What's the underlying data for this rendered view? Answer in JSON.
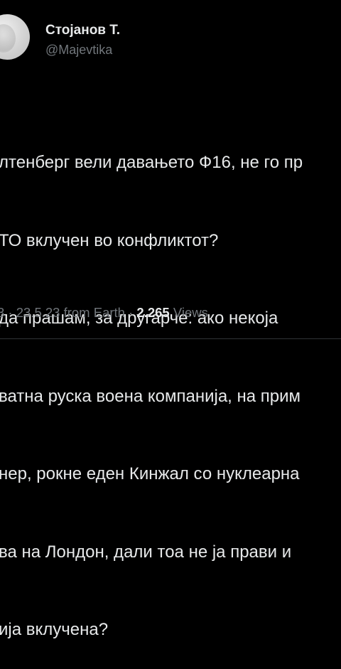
{
  "author": {
    "name": "Стојанов Т.",
    "handle": "@Majevtika"
  },
  "tweet": {
    "lines": [
      "лтенберг вели давањето Ф16, не го пр",
      "ТО вклучен во конфликтот?",
      "да прашам, за другарче: ако некоја",
      "ватна руска воена компанија, на прим",
      "нер, рокне еден Кинжал со нуклеарна",
      "ва на Лондон, дали тоа не ја прави и",
      "ија вклучена?"
    ]
  },
  "meta": {
    "time": "3 · 23.5.23 from Earth · ",
    "views_count": "2.265",
    "views_label": "Views"
  }
}
